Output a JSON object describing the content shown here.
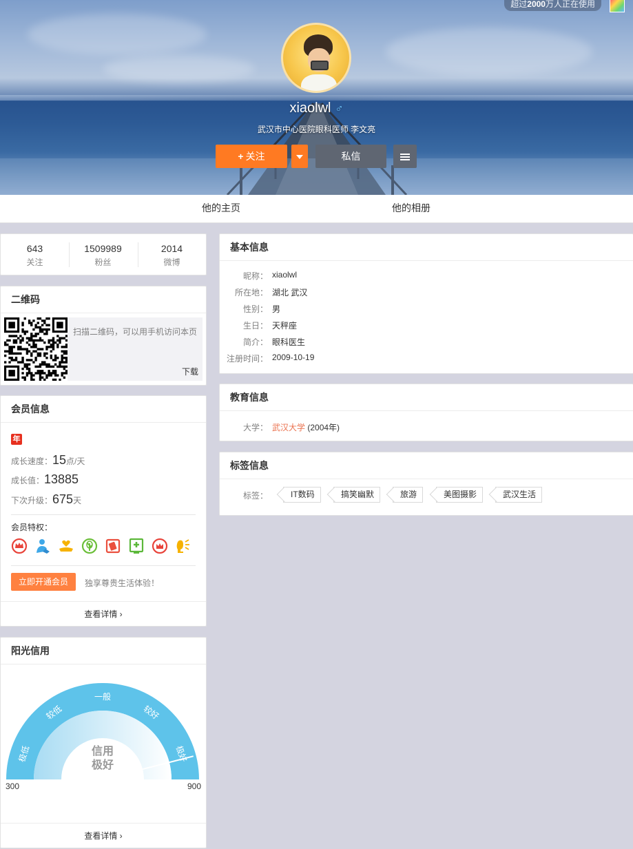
{
  "cover": {
    "top_badge_prefix": "超过",
    "top_badge_number": "2000",
    "top_badge_suffix": "万人正在使用"
  },
  "profile": {
    "username": "xiaolwl",
    "gender_icon": "male-symbol",
    "gender_glyph": "♂",
    "intro": "武汉市中心医院眼科医师 李文亮"
  },
  "actions": {
    "follow_label": "关注",
    "follow_plus": "+",
    "message_label": "私信"
  },
  "tabs": {
    "home": "他的主页",
    "album": "他的相册"
  },
  "stats": [
    {
      "num": "643",
      "label": "关注"
    },
    {
      "num": "1509989",
      "label": "粉丝"
    },
    {
      "num": "2014",
      "label": "微博"
    }
  ],
  "qr": {
    "title": "二维码",
    "tip": "扫描二维码，可以用手机访问本页",
    "download": "下载"
  },
  "member": {
    "title": "会员信息",
    "year_badge": "年",
    "speed_label": "成长速度：",
    "speed_value": "15",
    "speed_unit": "点/天",
    "growth_label": "成长值：",
    "growth_value": "13885",
    "next_label": "下次升级：",
    "next_value": "675",
    "next_unit": "天",
    "privileges_label": "会员特权：",
    "privileges": [
      {
        "icon": "crown-icon",
        "color": "#e8433a"
      },
      {
        "icon": "person-icon",
        "color": "#3fa8e8"
      },
      {
        "icon": "heart-hand-icon",
        "color": "#f6b200"
      },
      {
        "icon": "leaf-icon",
        "color": "#6cbf3a"
      },
      {
        "icon": "cards-icon",
        "color": "#ea4f3d"
      },
      {
        "icon": "medical-icon",
        "color": "#5cb83a"
      },
      {
        "icon": "crown-badge-icon",
        "color": "#e8433a"
      },
      {
        "icon": "speaker-icon",
        "color": "#f6b200"
      }
    ],
    "open_button": "立即开通会员",
    "open_tip": "独享尊贵生活体验！",
    "more": "查看详情"
  },
  "credit": {
    "title": "阳光信用",
    "levels": [
      "极低",
      "较低",
      "一般",
      "较好",
      "极好"
    ],
    "center_line1": "信用",
    "center_line2": "极好",
    "min": "300",
    "max": "900",
    "score_fraction": 0.92,
    "color": "#5ec3ea",
    "more": "查看详情"
  },
  "basic": {
    "title": "基本信息",
    "rows": [
      {
        "k": "昵称：",
        "v": "xiaolwl"
      },
      {
        "k": "所在地：",
        "v": "湖北 武汉"
      },
      {
        "k": "性别：",
        "v": "男"
      },
      {
        "k": "生日：",
        "v": "天秤座"
      },
      {
        "k": "简介：",
        "v": "眼科医生"
      },
      {
        "k": "注册时间：",
        "v": "2009-10-19"
      }
    ]
  },
  "education": {
    "title": "教育信息",
    "label": "大学：",
    "school": "武汉大学",
    "year": "(2004年)"
  },
  "tags": {
    "title": "标签信息",
    "label": "标签：",
    "items": [
      "IT数码",
      "搞笑幽默",
      "旅游",
      "美图摄影",
      "武汉生活"
    ]
  }
}
